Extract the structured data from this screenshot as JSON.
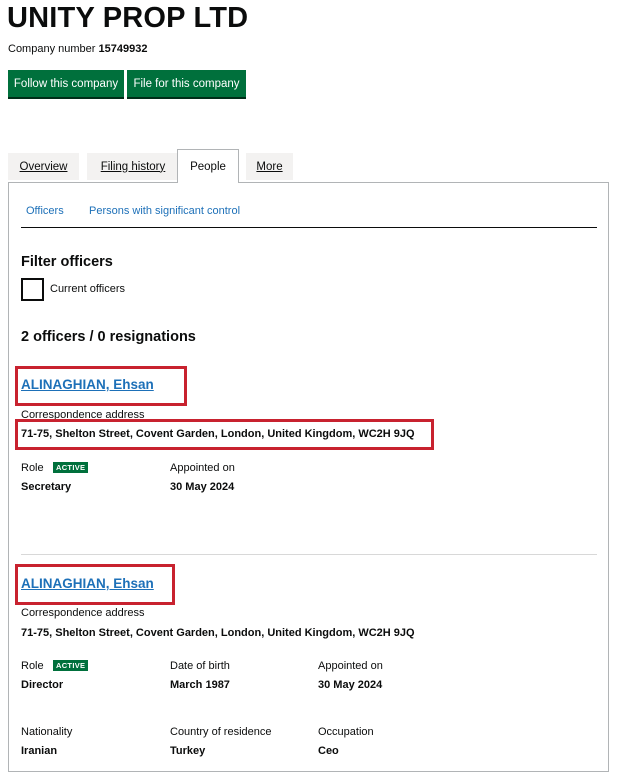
{
  "company": {
    "name": "UNITY PROP LTD",
    "number_label": "Company number",
    "number": "15749932"
  },
  "buttons": {
    "follow": "Follow this company",
    "file": "File for this company"
  },
  "tabs": [
    "Overview",
    "Filing history",
    "People",
    "More"
  ],
  "subtabs": [
    "Officers",
    "Persons with significant control"
  ],
  "filter": {
    "heading": "Filter officers",
    "checkbox_label": "Current officers"
  },
  "officer_count": "2 officers / 0 resignations",
  "officers": [
    {
      "name": "ALINAGHIAN, Ehsan",
      "address_label": "Correspondence address",
      "address": "71-75, Shelton Street, Covent Garden, London, United Kingdom, WC2H 9JQ",
      "role_label": "Role",
      "status": "ACTIVE",
      "role": "Secretary",
      "appointed_label": "Appointed on",
      "appointed": "30 May 2024"
    },
    {
      "name": "ALINAGHIAN, Ehsan",
      "address_label": "Correspondence address",
      "address": "71-75, Shelton Street, Covent Garden, London, United Kingdom, WC2H 9JQ",
      "role_label": "Role",
      "status": "ACTIVE",
      "role": "Director",
      "dob_label": "Date of birth",
      "dob": "March 1987",
      "appointed_label": "Appointed on",
      "appointed": "30 May 2024",
      "nationality_label": "Nationality",
      "nationality": "Iranian",
      "residence_label": "Country of residence",
      "residence": "Turkey",
      "occupation_label": "Occupation",
      "occupation": "Ceo"
    }
  ],
  "colors": {
    "green": "#00703c",
    "link": "#1d70b8",
    "highlight": "#c8222f"
  }
}
